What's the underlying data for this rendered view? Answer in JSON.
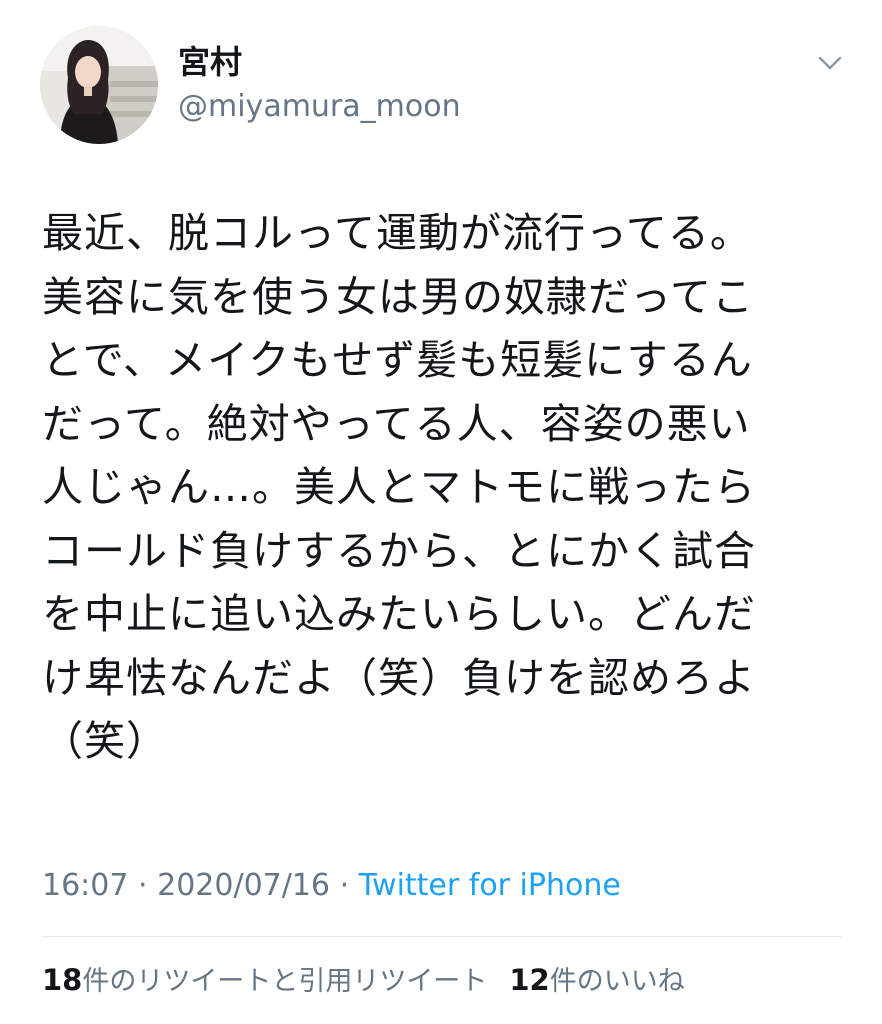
{
  "author": {
    "display_name": "宮村",
    "handle": "@miyamura_moon"
  },
  "tweet": {
    "text_lines": [
      "最近、脱コルって運動が流行ってる。",
      "美容に気を使う女は男の奴隷だってこ",
      "とで、メイクもせず髪も短髪にするん",
      "だって。絶対やってる人、容姿の悪い",
      "人じゃん…。美人とマトモに戦ったら",
      "コールド負けするから、とにかく試合",
      "を中止に追い込みたいらしい。どんだ",
      "け卑怯なんだよ（笑）負けを認めろよ",
      "（笑）"
    ],
    "time": "16:07",
    "date": "2020/07/16",
    "separator": "·",
    "source": "Twitter for iPhone"
  },
  "stats": {
    "retweet_count": "18",
    "retweet_label": "件のリツイートと引用リツイート",
    "like_count": "12",
    "like_label": "件のいいね"
  },
  "colors": {
    "text": "#14171a",
    "secondary": "#657786",
    "link": "#1da1f2",
    "divider": "#e1e8ed"
  },
  "icons": {
    "menu": "chevron-down-icon",
    "avatar": "profile-photo"
  }
}
